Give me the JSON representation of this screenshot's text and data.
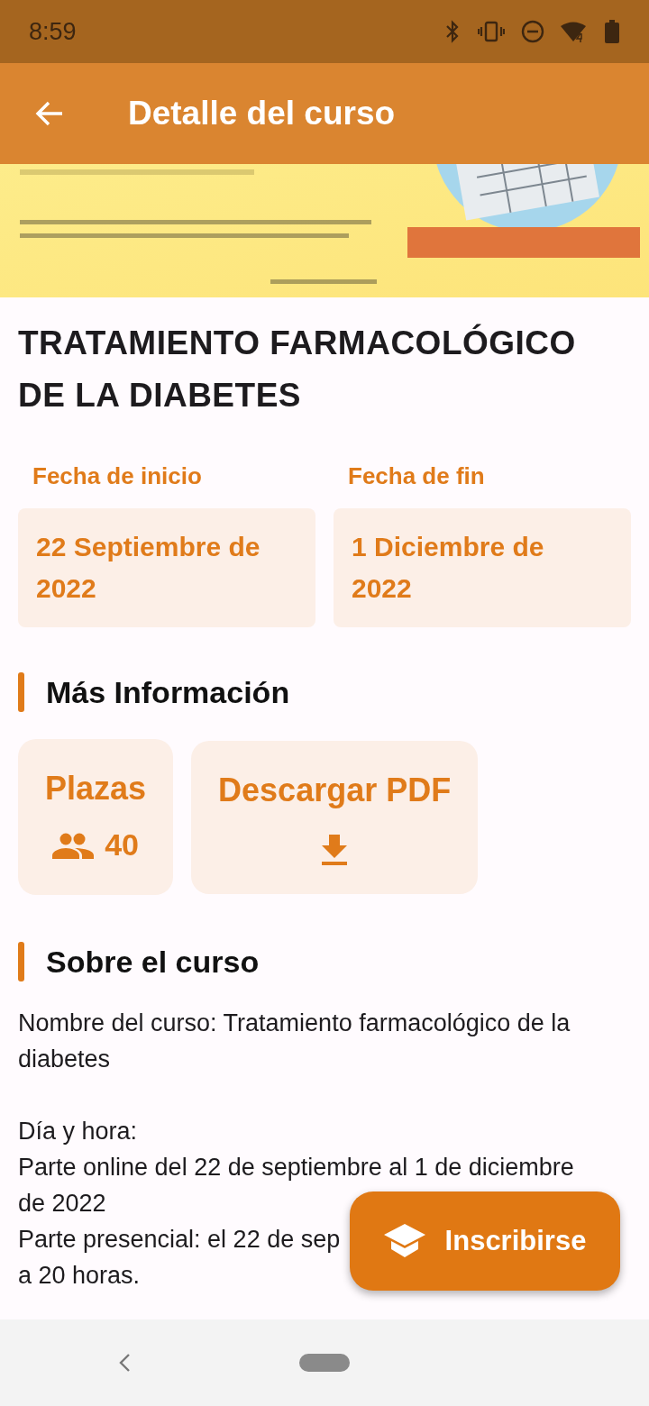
{
  "status_bar": {
    "time": "8:59"
  },
  "app_bar": {
    "title": "Detalle del curso"
  },
  "course": {
    "title": "TRATAMIENTO FARMACOLÓGICO DE LA DIABETES"
  },
  "dates": [
    {
      "label": "Fecha de inicio",
      "value": "22 Septiembre de 2022"
    },
    {
      "label": "Fecha de fin",
      "value": "1 Diciembre de 2022"
    }
  ],
  "more_info": {
    "heading": "Más Información",
    "cards": [
      {
        "kind": "seats",
        "title": "Plazas",
        "value": "40"
      },
      {
        "kind": "download",
        "title": "Descargar PDF"
      }
    ]
  },
  "about": {
    "heading": "Sobre el curso",
    "paragraphs": [
      [
        "Nombre del curso: Tratamiento farmacológico de la",
        "diabetes"
      ],
      [
        "Día y hora:",
        "Parte online del 22 de septiembre al 1 de diciembre",
        "de 2022",
        "Parte presencial: el 22 de sep",
        "a 20 horas."
      ]
    ]
  },
  "fab": {
    "label": "Inscribirse"
  }
}
